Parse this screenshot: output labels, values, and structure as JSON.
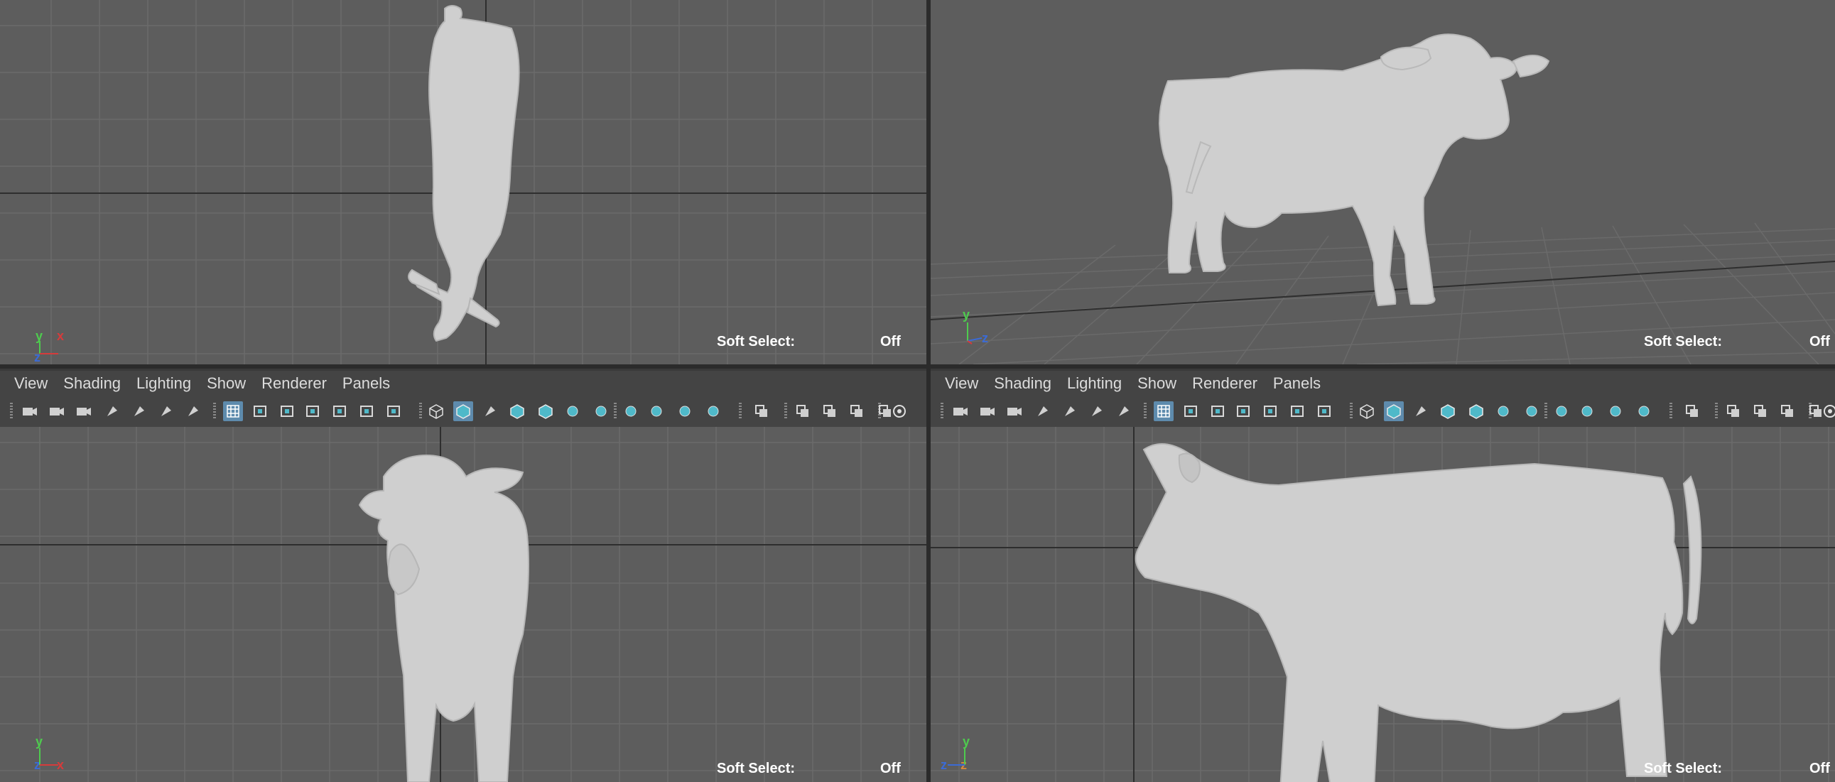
{
  "viewports": {
    "top": {
      "soft_select_label": "Soft Select:",
      "soft_select_value": "Off",
      "axis_a": "y",
      "axis_b": "x",
      "axis_c": "z"
    },
    "persp": {
      "soft_select_label": "Soft Select:",
      "soft_select_value": "Off",
      "axis_a": "y",
      "axis_b": "z"
    },
    "front": {
      "soft_select_label": "Soft Select:",
      "soft_select_value": "Off",
      "axis_a": "y",
      "axis_b": "z",
      "axis_c": "x"
    },
    "side": {
      "soft_select_label": "Soft Select:",
      "soft_select_value": "Off",
      "axis_a": "y",
      "axis_b": "z",
      "axis_c": "z"
    }
  },
  "panel_menu_left": {
    "view": "View",
    "shading": "Shading",
    "lighting": "Lighting",
    "show": "Show",
    "renderer": "Renderer",
    "panels": "Panels"
  },
  "panel_menu_right": {
    "view": "View",
    "shading": "Shading",
    "lighting": "Lighting",
    "show": "Show",
    "renderer": "Renderer",
    "panels": "Panels"
  },
  "colors": {
    "accent": "#5e8bad",
    "icon_cyan": "#4fb9c9",
    "viewport_bg": "#5d5d5d",
    "panel_bg": "#444444",
    "axis_x": "#d63b3b",
    "axis_y": "#4ecb4e",
    "axis_z": "#3b6bd6"
  },
  "toolbar_icons": [
    "camera-icon",
    "camera-lock-icon",
    "camera-attributes-icon",
    "bookmark-icon",
    "image-plane-icon",
    "2d-pan-zoom-icon",
    "grease-pencil-icon",
    "grid-icon",
    "film-gate-icon",
    "resolution-gate-icon",
    "gate-mask-icon",
    "field-chart-icon",
    "safe-action-icon",
    "safe-title-icon",
    "wireframe-icon",
    "smooth-shade-icon",
    "default-material-icon",
    "wireframe-on-shaded-icon",
    "textured-icon",
    "use-all-lights-icon",
    "shadows-icon",
    "screen-space-ao-icon",
    "motion-blur-icon",
    "anti-alias-icon",
    "depth-of-field-icon",
    "isolate-select-icon",
    "xray-icon",
    "xray-joints-icon",
    "xray-active-icon",
    "backface-cull-icon",
    "exposure-icon"
  ]
}
